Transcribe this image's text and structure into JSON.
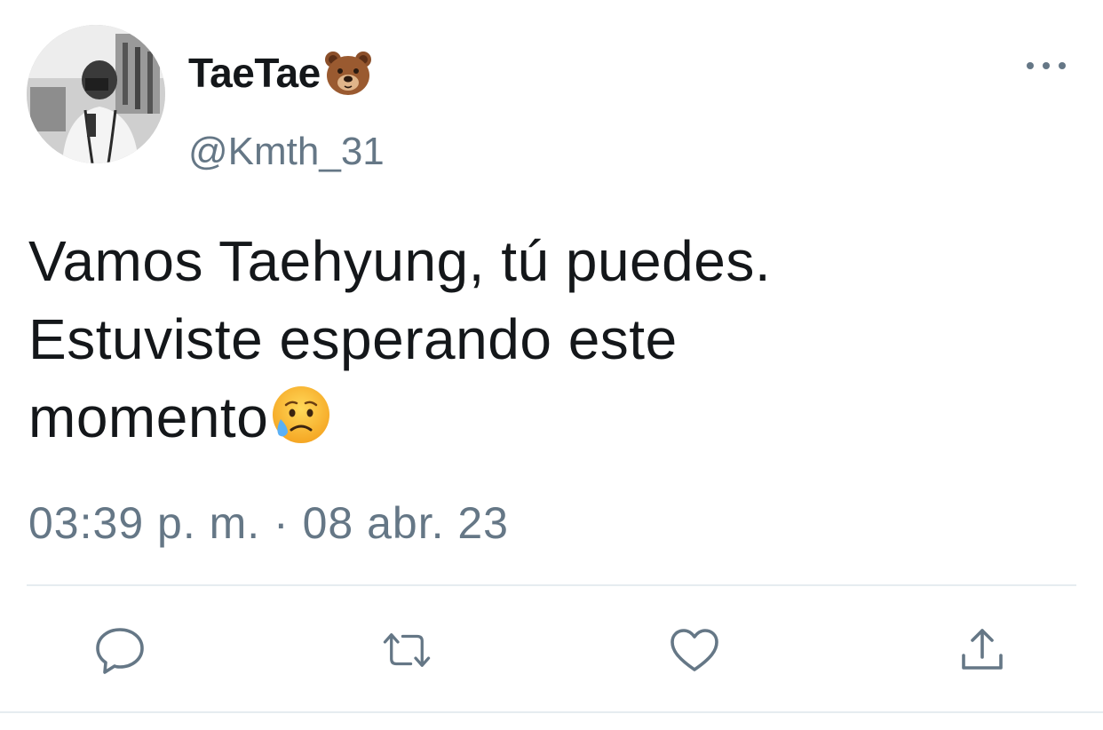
{
  "tweet": {
    "author": {
      "display_name": "TaeTae",
      "name_emoji": "bear-face",
      "handle": "@Kmth_31"
    },
    "text_lines": [
      "Vamos Taehyung, tú puedes.",
      "Estuviste esperando este",
      "momento"
    ],
    "text_emoji": "sad-but-relieved-face",
    "timestamp": "03:39 p. m. · 08 abr. 23"
  },
  "actions": [
    "reply-icon",
    "retweet-icon",
    "like-icon",
    "share-icon"
  ],
  "colors": {
    "text": "#14171a",
    "secondary": "#657786",
    "divider": "#e6ecf0",
    "background": "#ffffff"
  }
}
